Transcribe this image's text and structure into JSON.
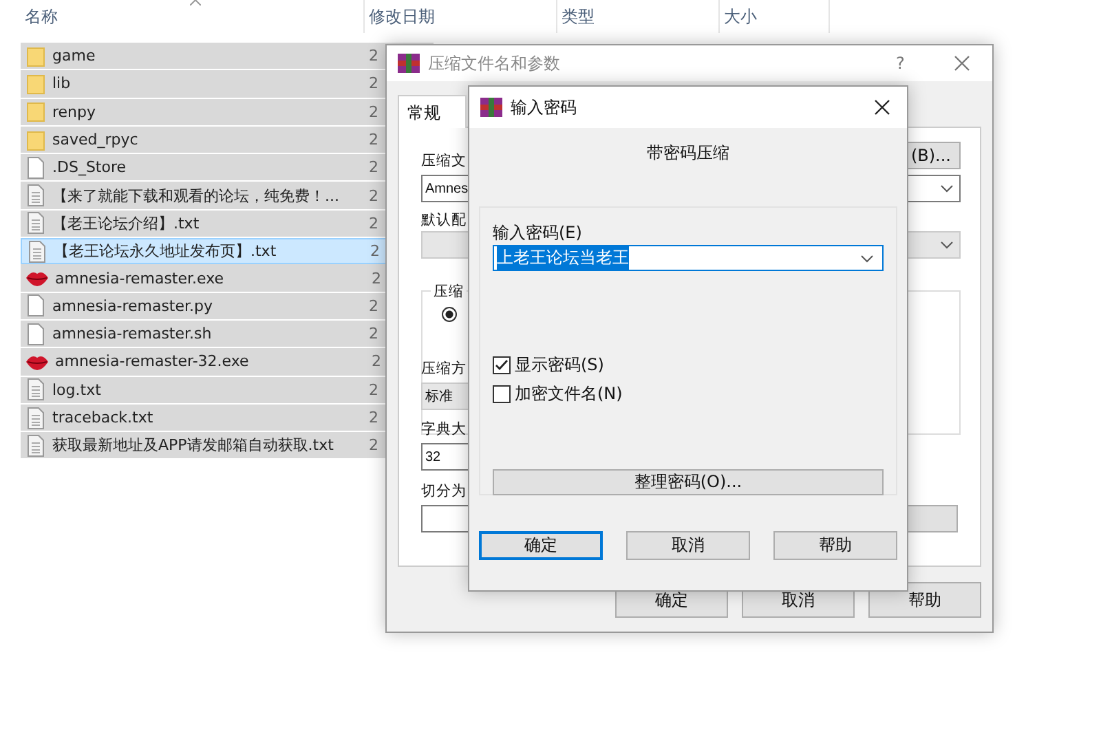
{
  "file_list": {
    "columns": [
      "名称",
      "修改日期",
      "类型",
      "大小"
    ],
    "rows": [
      {
        "kind": "folder",
        "name": "game",
        "date": "2",
        "selected": true,
        "focused": false
      },
      {
        "kind": "folder",
        "name": "lib",
        "date": "2",
        "selected": true,
        "focused": false
      },
      {
        "kind": "folder",
        "name": "renpy",
        "date": "2",
        "selected": true,
        "focused": false
      },
      {
        "kind": "folder",
        "name": "saved_rpyc",
        "date": "2",
        "selected": true,
        "focused": false
      },
      {
        "kind": "file",
        "name": ".DS_Store",
        "date": "2",
        "selected": true,
        "focused": false
      },
      {
        "kind": "text",
        "name": "【来了就能下载和观看的论坛，纯免费！...",
        "date": "2",
        "selected": true,
        "focused": false
      },
      {
        "kind": "text",
        "name": "【老王论坛介绍】.txt",
        "date": "2",
        "selected": true,
        "focused": false
      },
      {
        "kind": "text",
        "name": "【老王论坛永久地址发布页】.txt",
        "date": "2",
        "selected": true,
        "focused": true
      },
      {
        "kind": "exe",
        "name": "amnesia-remaster.exe",
        "date": "2",
        "selected": true,
        "focused": false
      },
      {
        "kind": "file",
        "name": "amnesia-remaster.py",
        "date": "2",
        "selected": true,
        "focused": false
      },
      {
        "kind": "file",
        "name": "amnesia-remaster.sh",
        "date": "2",
        "selected": true,
        "focused": false
      },
      {
        "kind": "exe",
        "name": "amnesia-remaster-32.exe",
        "date": "2",
        "selected": true,
        "focused": false
      },
      {
        "kind": "text",
        "name": "log.txt",
        "date": "2",
        "selected": true,
        "focused": false
      },
      {
        "kind": "text",
        "name": "traceback.txt",
        "date": "2",
        "selected": true,
        "focused": false
      },
      {
        "kind": "text",
        "name": "获取最新地址及APP请发邮箱自动获取.txt",
        "date": "2",
        "selected": true,
        "focused": false
      }
    ]
  },
  "archive_dialog": {
    "title": "压缩文件名和参数",
    "help": "?",
    "tab": {
      "label": "常规",
      "selected": true
    },
    "archive_name_label": "压缩文",
    "archive_name_value": "Amnes",
    "browse_button": "(B)...",
    "profile_label": "默认配",
    "format_group_label": "压缩",
    "format_radio_selected": true,
    "method_label": "压缩方",
    "method_value": "标准",
    "dictionary_label": "字典大",
    "dictionary_value": "32",
    "split_label": "切分为",
    "buttons": [
      "确定",
      "取消",
      "帮助"
    ]
  },
  "password_dialog": {
    "title": "输入密码",
    "heading": "带密码压缩",
    "password_label": "输入密码(E)",
    "password_value": "上老王论坛当老王",
    "options": [
      {
        "label": "显示密码(S)",
        "checked": true
      },
      {
        "label": "加密文件名(N)",
        "checked": false
      }
    ],
    "organize_button": "整理密码(O)...",
    "buttons": [
      {
        "label": "确定",
        "default": true
      },
      {
        "label": "取消",
        "default": false
      },
      {
        "label": "帮助",
        "default": false
      }
    ]
  }
}
